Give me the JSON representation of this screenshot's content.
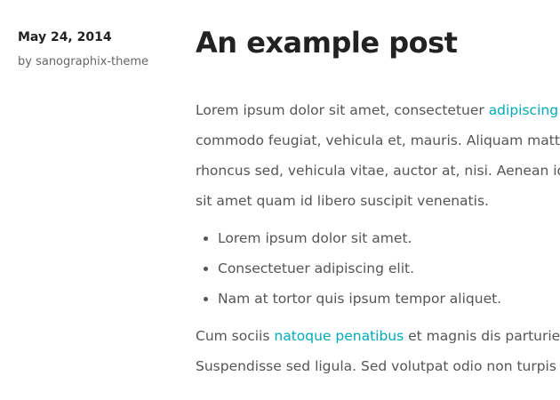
{
  "meta": {
    "date": "May 24, 2014",
    "author": "by sanographix-theme"
  },
  "post": {
    "title": "An example post",
    "paragraph1": {
      "lines": [
        {
          "before": "Lorem ipsum dolor sit amet, consectetuer ",
          "link": "adipiscing",
          "after": ""
        },
        {
          "before": "commodo feugiat, vehicula et, mauris. Aliquam matti"
        },
        {
          "before": "rhoncus sed, vehicula vitae, auctor at, nisi. Aenean id"
        },
        {
          "before": "sit amet quam id libero suscipit venenatis."
        }
      ]
    },
    "list": [
      "Lorem ipsum dolor sit amet.",
      "Consectetuer adipiscing elit.",
      "Nam at tortor quis ipsum tempor aliquet."
    ],
    "paragraph2": {
      "lines": [
        {
          "before": "Cum sociis ",
          "link": "natoque penatibus",
          "after": " et magnis dis parturier"
        },
        {
          "before": "Suspendisse sed ligula. Sed volutpat odio non turpis g"
        }
      ]
    },
    "link_color": "#00aab5"
  }
}
